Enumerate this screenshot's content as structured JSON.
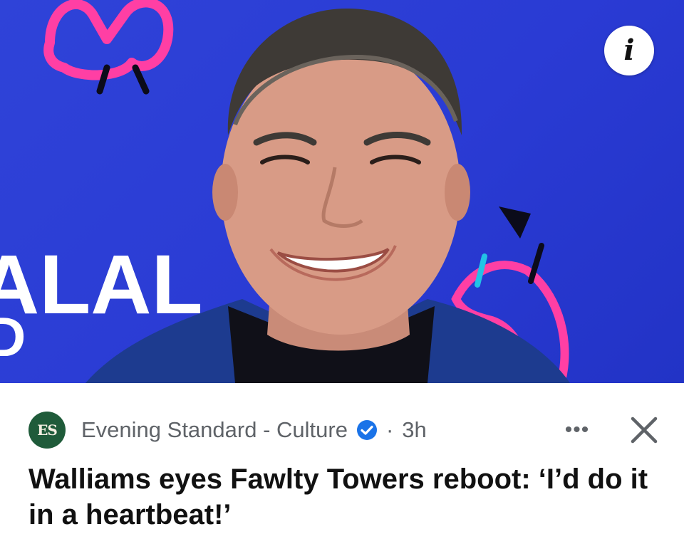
{
  "hero": {
    "backdrop_text": "ALAL",
    "backdrop_text_2": "D",
    "info_icon": "info-icon",
    "info_glyph": "i"
  },
  "source": {
    "logo_text": "ES",
    "name": "Evening Standard - Culture",
    "verified_icon": "verified-badge-icon",
    "separator": "·",
    "age": "3h"
  },
  "actions": {
    "more_glyph": "•••",
    "more_icon": "more-options-icon",
    "close_icon": "close-icon"
  },
  "article": {
    "headline": "Walliams eyes Fawlty Towers reboot: ‘I’d do it in a heartbeat!’"
  },
  "colors": {
    "backdrop_blue": "#2a3bd4",
    "logo_green": "#1f5b3a",
    "verified_blue": "#1a73e8",
    "meta_gray": "#5f6368"
  }
}
